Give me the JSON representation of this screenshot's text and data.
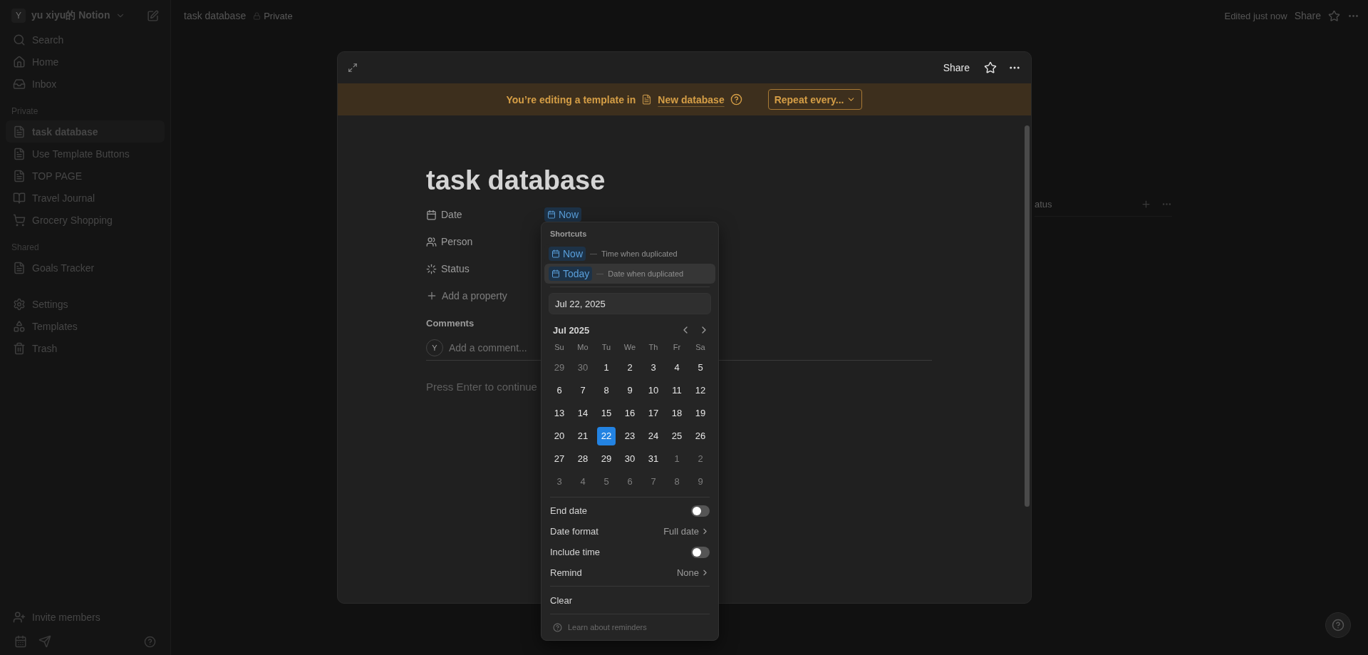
{
  "sidebar": {
    "workspace": {
      "avatar": "Y",
      "name": "yu xiyu的 Notion"
    },
    "nav": [
      {
        "kind": "search",
        "label": "Search"
      },
      {
        "kind": "home",
        "label": "Home"
      },
      {
        "kind": "inbox",
        "label": "Inbox"
      }
    ],
    "sections": [
      {
        "title": "Private",
        "items": [
          {
            "kind": "page",
            "label": "task database",
            "selected": true
          },
          {
            "kind": "page",
            "label": "Use Template Buttons",
            "selected": false
          },
          {
            "kind": "page",
            "label": "TOP PAGE",
            "selected": false
          },
          {
            "kind": "journal",
            "label": "Travel Journal",
            "selected": false
          },
          {
            "kind": "cart",
            "label": "Grocery Shopping",
            "selected": false
          }
        ]
      },
      {
        "title": "Shared",
        "items": [
          {
            "kind": "page",
            "label": "Goals Tracker",
            "selected": false
          }
        ]
      }
    ],
    "utilities": [
      {
        "kind": "settings",
        "label": "Settings"
      },
      {
        "kind": "templates",
        "label": "Templates"
      },
      {
        "kind": "trash",
        "label": "Trash"
      }
    ],
    "invite": "Invite members"
  },
  "topbar": {
    "breadcrumb": "task database",
    "privacy": "Private",
    "edited": "Edited just now",
    "share": "Share"
  },
  "background_table": {
    "column_header": "atus"
  },
  "modal": {
    "share": "Share",
    "banner": {
      "text": "You’re editing a template in",
      "link": "New database",
      "repeat": "Repeat every..."
    },
    "title": "task database",
    "properties": [
      {
        "kind": "date",
        "label": "Date",
        "value": "Now"
      },
      {
        "kind": "person",
        "label": "Person"
      },
      {
        "kind": "status",
        "label": "Status"
      }
    ],
    "add_property": "Add a property",
    "comments": {
      "heading": "Comments",
      "avatar": "Y",
      "placeholder": "Add a comment..."
    },
    "body_placeholder": "Press Enter to continue"
  },
  "date_picker": {
    "shortcuts_title": "Shortcuts",
    "shortcuts": [
      {
        "label": "Now",
        "hint": "Time when duplicated",
        "selected": false
      },
      {
        "label": "Today",
        "hint": "Date when duplicated",
        "selected": true
      }
    ],
    "input_value": "Jul 22, 2025",
    "month": "Jul 2025",
    "weekdays": [
      "Su",
      "Mo",
      "Tu",
      "We",
      "Th",
      "Fr",
      "Sa"
    ],
    "weeks": [
      [
        {
          "d": "29",
          "outside": true,
          "selected": false
        },
        {
          "d": "30",
          "outside": true,
          "selected": false
        },
        {
          "d": "1",
          "outside": false,
          "selected": false
        },
        {
          "d": "2",
          "outside": false,
          "selected": false
        },
        {
          "d": "3",
          "outside": false,
          "selected": false
        },
        {
          "d": "4",
          "outside": false,
          "selected": false
        },
        {
          "d": "5",
          "outside": false,
          "selected": false
        }
      ],
      [
        {
          "d": "6",
          "outside": false,
          "selected": false
        },
        {
          "d": "7",
          "outside": false,
          "selected": false
        },
        {
          "d": "8",
          "outside": false,
          "selected": false
        },
        {
          "d": "9",
          "outside": false,
          "selected": false
        },
        {
          "d": "10",
          "outside": false,
          "selected": false
        },
        {
          "d": "11",
          "outside": false,
          "selected": false
        },
        {
          "d": "12",
          "outside": false,
          "selected": false
        }
      ],
      [
        {
          "d": "13",
          "outside": false,
          "selected": false
        },
        {
          "d": "14",
          "outside": false,
          "selected": false
        },
        {
          "d": "15",
          "outside": false,
          "selected": false
        },
        {
          "d": "16",
          "outside": false,
          "selected": false
        },
        {
          "d": "17",
          "outside": false,
          "selected": false
        },
        {
          "d": "18",
          "outside": false,
          "selected": false
        },
        {
          "d": "19",
          "outside": false,
          "selected": false
        }
      ],
      [
        {
          "d": "20",
          "outside": false,
          "selected": false
        },
        {
          "d": "21",
          "outside": false,
          "selected": false
        },
        {
          "d": "22",
          "outside": false,
          "selected": true
        },
        {
          "d": "23",
          "outside": false,
          "selected": false
        },
        {
          "d": "24",
          "outside": false,
          "selected": false
        },
        {
          "d": "25",
          "outside": false,
          "selected": false
        },
        {
          "d": "26",
          "outside": false,
          "selected": false
        }
      ],
      [
        {
          "d": "27",
          "outside": false,
          "selected": false
        },
        {
          "d": "28",
          "outside": false,
          "selected": false
        },
        {
          "d": "29",
          "outside": false,
          "selected": false
        },
        {
          "d": "30",
          "outside": false,
          "selected": false
        },
        {
          "d": "31",
          "outside": false,
          "selected": false
        },
        {
          "d": "1",
          "outside": true,
          "selected": false
        },
        {
          "d": "2",
          "outside": true,
          "selected": false
        }
      ],
      [
        {
          "d": "3",
          "outside": true,
          "selected": false
        },
        {
          "d": "4",
          "outside": true,
          "selected": false
        },
        {
          "d": "5",
          "outside": true,
          "selected": false
        },
        {
          "d": "6",
          "outside": true,
          "selected": false
        },
        {
          "d": "7",
          "outside": true,
          "selected": false
        },
        {
          "d": "8",
          "outside": true,
          "selected": false
        },
        {
          "d": "9",
          "outside": true,
          "selected": false
        }
      ]
    ],
    "settings": [
      {
        "kind": "toggle",
        "label": "End date",
        "on": false
      },
      {
        "kind": "select",
        "label": "Date format",
        "value": "Full date"
      },
      {
        "kind": "toggle",
        "label": "Include time",
        "on": false
      },
      {
        "kind": "select",
        "label": "Remind",
        "value": "None"
      }
    ],
    "clear": "Clear",
    "help": "Learn about reminders"
  }
}
